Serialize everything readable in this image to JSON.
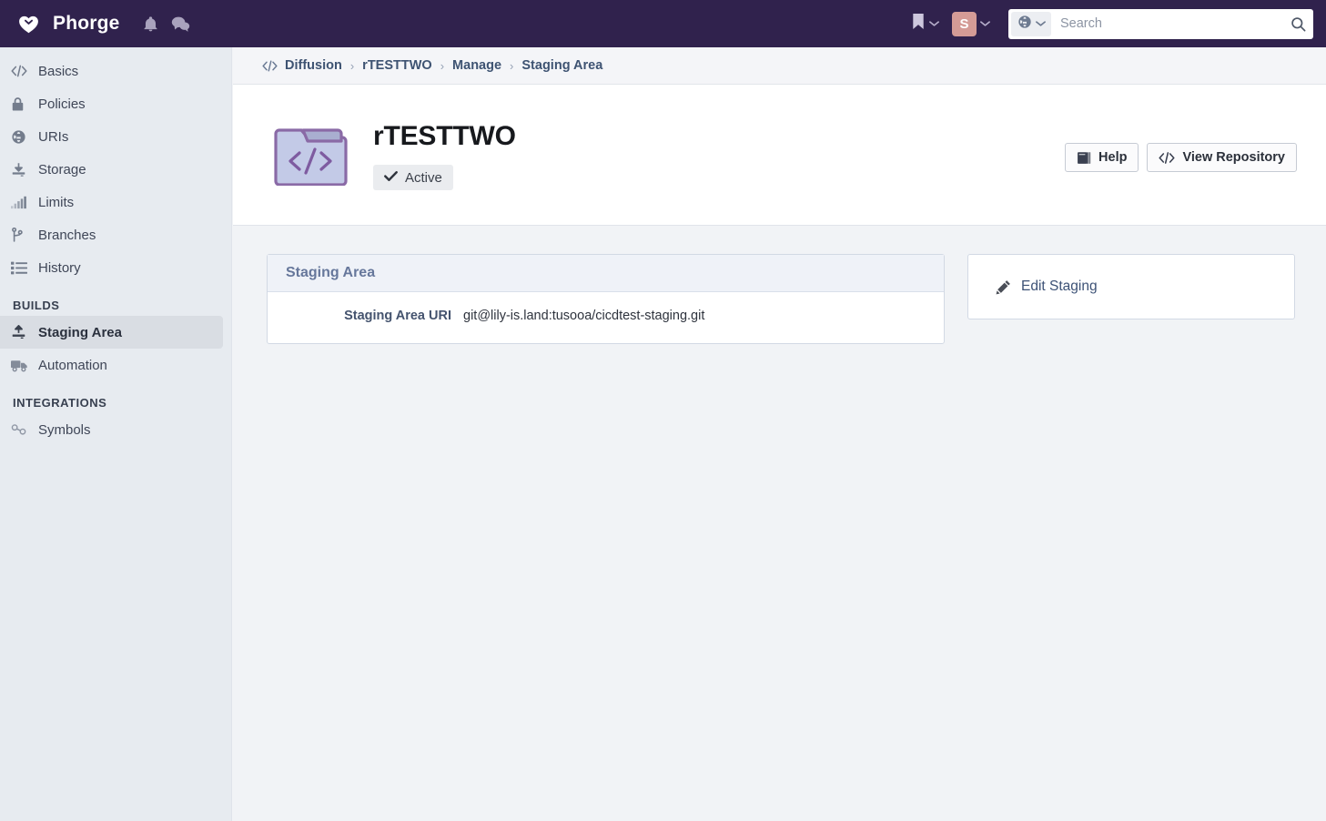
{
  "topbar": {
    "brand": "Phorge",
    "logo_icon": "heart-icon",
    "notifications_icon": "bell-icon",
    "messages_icon": "chat-bubbles-icon",
    "bookmark_icon": "bookmark-icon",
    "bookmark_caret_icon": "chevron-down-icon",
    "avatar_initial": "S",
    "avatar_caret_icon": "chevron-down-icon",
    "avatar_color": "#d49b96",
    "search": {
      "scope_icon": "globe-icon",
      "scope_caret_icon": "chevron-down-icon",
      "placeholder": "Search",
      "value": "",
      "submit_icon": "search-icon"
    },
    "background": "#30224d"
  },
  "sidebar": {
    "items": [
      {
        "label": "Basics",
        "icon": "code-icon",
        "selected": false
      },
      {
        "label": "Policies",
        "icon": "lock-icon",
        "selected": false
      },
      {
        "label": "URIs",
        "icon": "globe-icon",
        "selected": false
      },
      {
        "label": "Storage",
        "icon": "download-icon",
        "selected": false
      },
      {
        "label": "Limits",
        "icon": "signal-bars-icon",
        "selected": false
      },
      {
        "label": "Branches",
        "icon": "branch-icon",
        "selected": false
      },
      {
        "label": "History",
        "icon": "list-icon",
        "selected": false
      }
    ],
    "groups": [
      {
        "label": "BUILDS",
        "items": [
          {
            "label": "Staging Area",
            "icon": "upload-icon",
            "selected": true
          },
          {
            "label": "Automation",
            "icon": "truck-icon",
            "selected": false
          }
        ]
      },
      {
        "label": "INTEGRATIONS",
        "items": [
          {
            "label": "Symbols",
            "icon": "link-chain-icon",
            "selected": false
          }
        ]
      }
    ]
  },
  "breadcrumb": {
    "icon": "code-icon",
    "items": [
      "Diffusion",
      "rTESTTWO",
      "Manage",
      "Staging Area"
    ],
    "separator": "›"
  },
  "page_header": {
    "repo_icon": "repository-folder-code-icon",
    "title": "rTESTTWO",
    "status": {
      "icon": "check-icon",
      "label": "Active"
    },
    "actions": [
      {
        "label": "Help",
        "icon": "book-icon"
      },
      {
        "label": "View Repository",
        "icon": "code-icon"
      }
    ]
  },
  "main": {
    "panel": {
      "header": "Staging Area",
      "rows": [
        {
          "key": "Staging Area URI",
          "value": "git@lily-is.land:tusooa/cicdtest-staging.git"
        }
      ]
    },
    "side_panel": {
      "action": {
        "label": "Edit Staging",
        "icon": "pencil-icon"
      }
    }
  }
}
